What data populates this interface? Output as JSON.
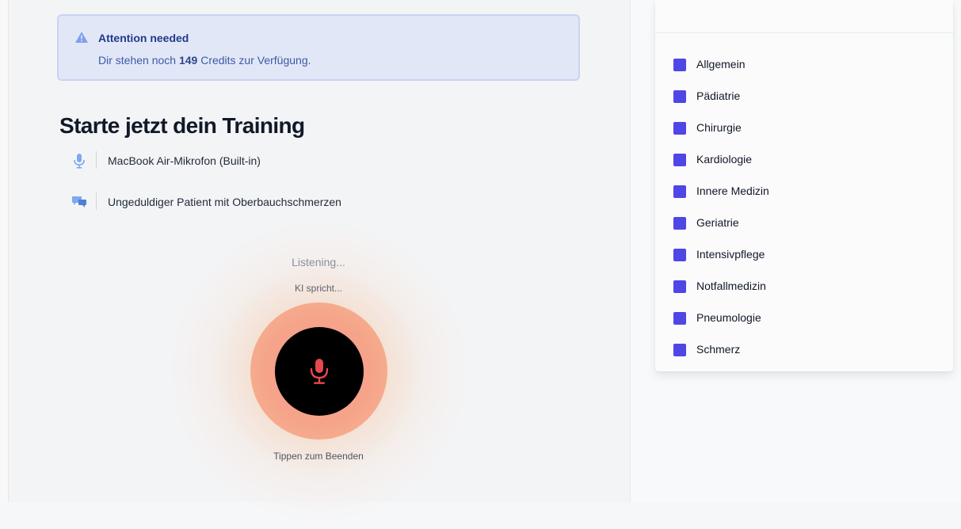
{
  "alert": {
    "title": "Attention needed",
    "text_before": "Dir stehen noch ",
    "credits": "149",
    "text_after": " Credits zur Verfügung."
  },
  "training": {
    "title": "Starte jetzt dein Training",
    "microphone": "MacBook Air-Mikrofon (Built-in)",
    "scenario": "Ungeduldiger Patient mit Oberbauchschmerzen"
  },
  "voice": {
    "status": "Listening...",
    "ai_status": "KI spricht...",
    "hint": "Tippen zum Beenden"
  },
  "categories": {
    "items": [
      "Allgemein",
      "Pädiatrie",
      "Chirurgie",
      "Kardiologie",
      "Innere Medizin",
      "Geriatrie",
      "Intensivpflege",
      "Notfallmedizin",
      "Pneumologie",
      "Schmerz"
    ],
    "checked": [
      true,
      true,
      true,
      true,
      true,
      true,
      true,
      true,
      true,
      true
    ]
  },
  "colors": {
    "accent": "#4f46e5",
    "alert_bg": "#e2e7f7",
    "alert_title": "#1e3a8a",
    "mic_icon": "#e5484d"
  }
}
